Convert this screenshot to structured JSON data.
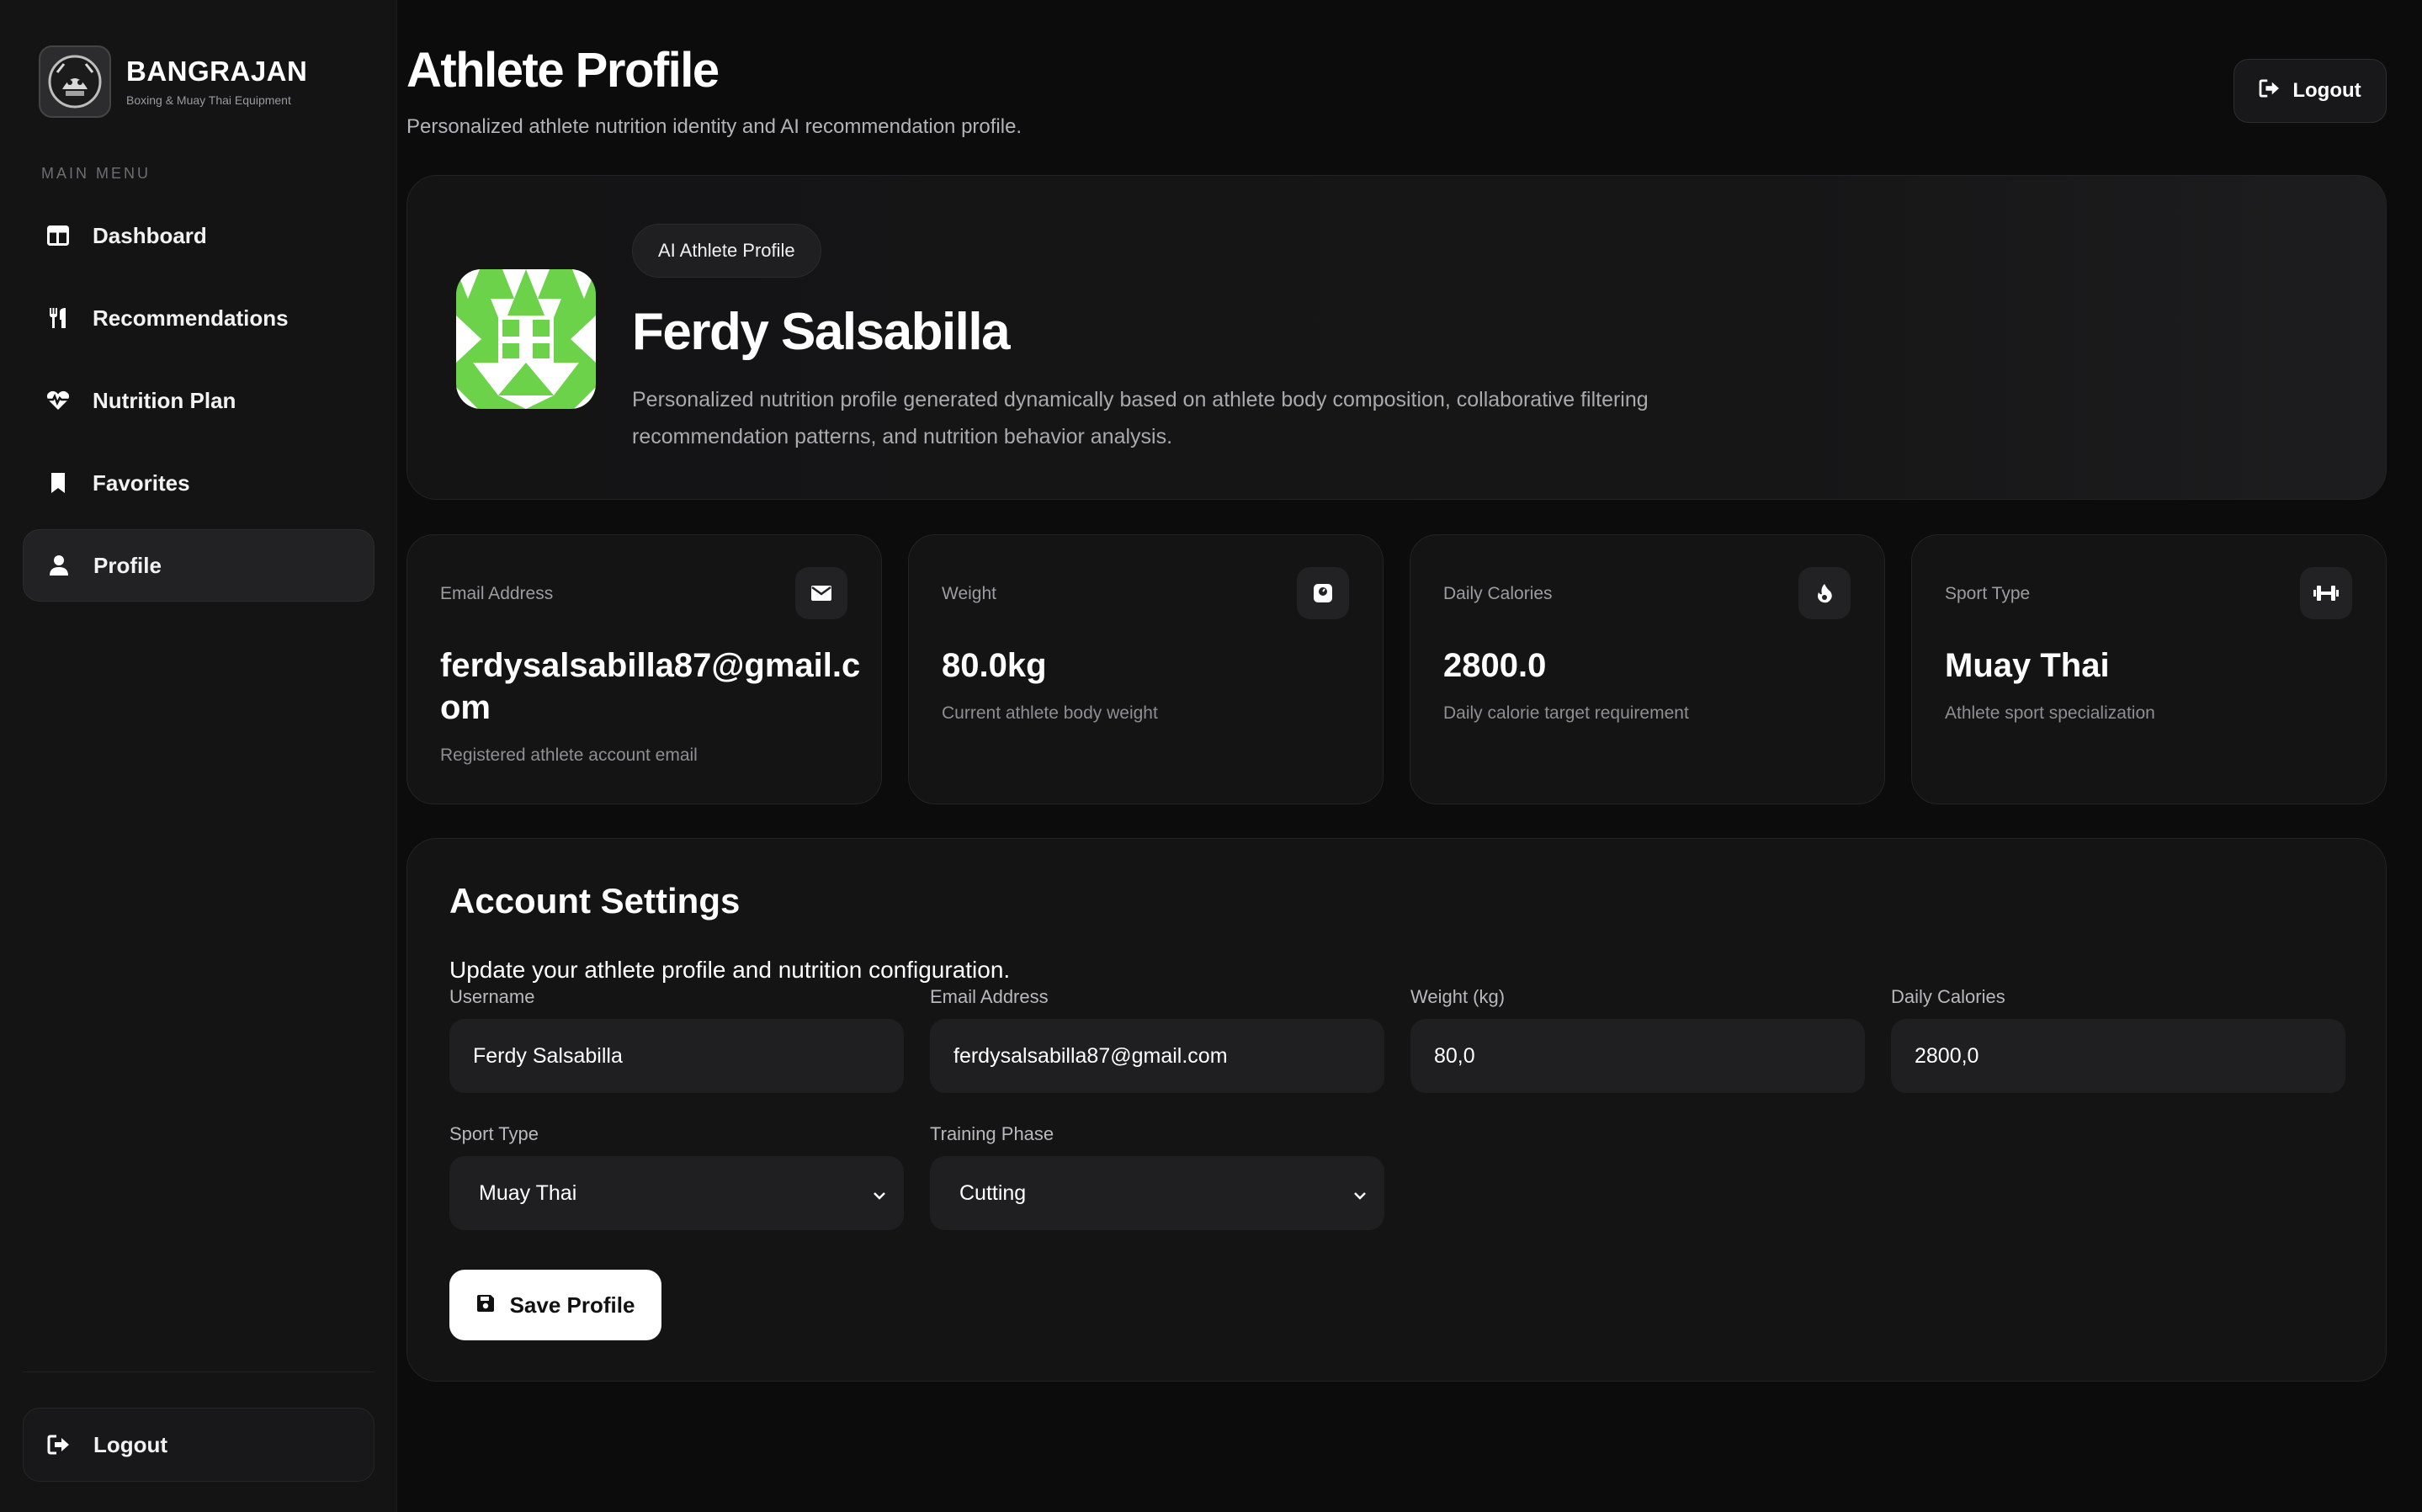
{
  "brand": {
    "name": "BANGRAJAN",
    "tagline": "Boxing & Muay Thai Equipment"
  },
  "sidebar": {
    "menu_label": "MAIN MENU",
    "items": [
      {
        "label": "Dashboard",
        "icon": "dashboard-icon"
      },
      {
        "label": "Recommendations",
        "icon": "utensils-icon"
      },
      {
        "label": "Nutrition Plan",
        "icon": "heart-pulse-icon"
      },
      {
        "label": "Favorites",
        "icon": "bookmark-icon"
      },
      {
        "label": "Profile",
        "icon": "user-icon",
        "active": true
      }
    ],
    "logout_label": "Logout"
  },
  "header": {
    "title": "Athlete Profile",
    "subtitle": "Personalized athlete nutrition identity and AI recommendation profile.",
    "logout_label": "Logout"
  },
  "hero": {
    "badge": "AI Athlete Profile",
    "name": "Ferdy Salsabilla",
    "description": "Personalized nutrition profile generated dynamically based on athlete body composition, collaborative filtering recommendation patterns, and nutrition behavior analysis.",
    "avatar_color": "#6bd24a"
  },
  "stats": [
    {
      "label": "Email Address",
      "value": "ferdysalsabilla87@gmail.com",
      "hint": "Registered athlete account email",
      "icon": "envelope-icon"
    },
    {
      "label": "Weight",
      "value": "80.0kg",
      "hint": "Current athlete body weight",
      "icon": "weight-scale-icon"
    },
    {
      "label": "Daily Calories",
      "value": "2800.0",
      "hint": "Daily calorie target requirement",
      "icon": "fire-icon"
    },
    {
      "label": "Sport Type",
      "value": "Muay Thai",
      "hint": "Athlete sport specialization",
      "icon": "dumbbell-icon"
    }
  ],
  "settings": {
    "title": "Account Settings",
    "subtitle": "Update your athlete profile and nutrition configuration.",
    "fields": {
      "username": {
        "label": "Username",
        "value": "Ferdy Salsabilla"
      },
      "email": {
        "label": "Email Address",
        "value": "ferdysalsabilla87@gmail.com"
      },
      "weight": {
        "label": "Weight (kg)",
        "value": "80,0"
      },
      "calories": {
        "label": "Daily Calories",
        "value": "2800,0"
      },
      "sport": {
        "label": "Sport Type",
        "value": "Muay Thai"
      },
      "phase": {
        "label": "Training Phase",
        "value": "Cutting"
      }
    },
    "save_label": "Save Profile"
  }
}
